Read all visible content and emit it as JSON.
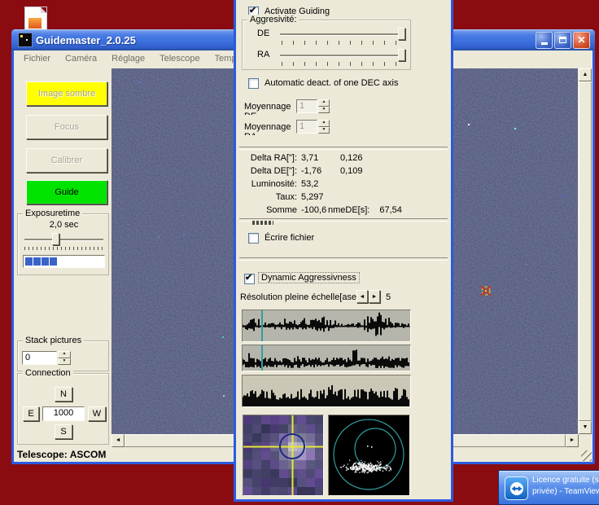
{
  "main_window": {
    "title": "Guidemaster_2.0.25",
    "menu": [
      "Fichier",
      "Caméra",
      "Réglage",
      "Telescope",
      "Temporisation"
    ],
    "buttons": {
      "dark_frame": "Image sombre",
      "focus": "Focus",
      "calibrate": "Calibrer",
      "guide": "Guide"
    },
    "exposure": {
      "group_label": "Exposuretime",
      "value": "2,0 sec"
    },
    "stack": {
      "group_label": "Stack pictures",
      "value": "0"
    },
    "connection": {
      "group_label": "Connection",
      "north": "N",
      "east": "E",
      "west": "W",
      "south": "S",
      "pulse": "1000"
    },
    "statusbar": "Telescope: ASCOM"
  },
  "dialog": {
    "activate_guiding": "Activate Guiding",
    "aggressivity": {
      "group_label": "Aggresivité:",
      "de_label": "DE",
      "ra_label": "RA"
    },
    "auto_deact": "Automatic deact. of one DEC axis",
    "averaging": [
      {
        "label": "Moyennage",
        "label2": "DE",
        "value": "1"
      },
      {
        "label": "Moyennage",
        "label2": "RA",
        "value": "1"
      }
    ],
    "stats": [
      {
        "label": "Delta RA[\"]:",
        "v1": "3,71",
        "v2": "0,126",
        "v3": ""
      },
      {
        "label": "Delta DE[\"]:",
        "v1": "-1,76",
        "v2": "0,109",
        "v3": ""
      },
      {
        "label": "Luminosité:",
        "v1": "53,2",
        "v2": "",
        "v3": ""
      },
      {
        "label": "Taux:",
        "v1": "5,297",
        "v2": "",
        "v3": ""
      },
      {
        "label": "Somme",
        "v1": "-100,6",
        "v2": "nmeDE[s]:",
        "v3": "67,54"
      }
    ],
    "write_file": "Écrire fichier",
    "dynamic_aggressivness": "Dynamic Aggressivness",
    "resolution_label": "Résolution pleine échelle[asec]:",
    "resolution_value": "5"
  },
  "teamviewer_toast": {
    "line1": "Licence gratuite (s",
    "line2": "privée) - TeamView"
  },
  "colors": {
    "desktop_red": "#8a0c10",
    "xp_border_blue": "#2a5adf",
    "xp_beige": "#ece9d8",
    "accent_yellow": "#ffff00",
    "accent_green": "#00e400",
    "teal_marker": "#2f9f9f"
  }
}
